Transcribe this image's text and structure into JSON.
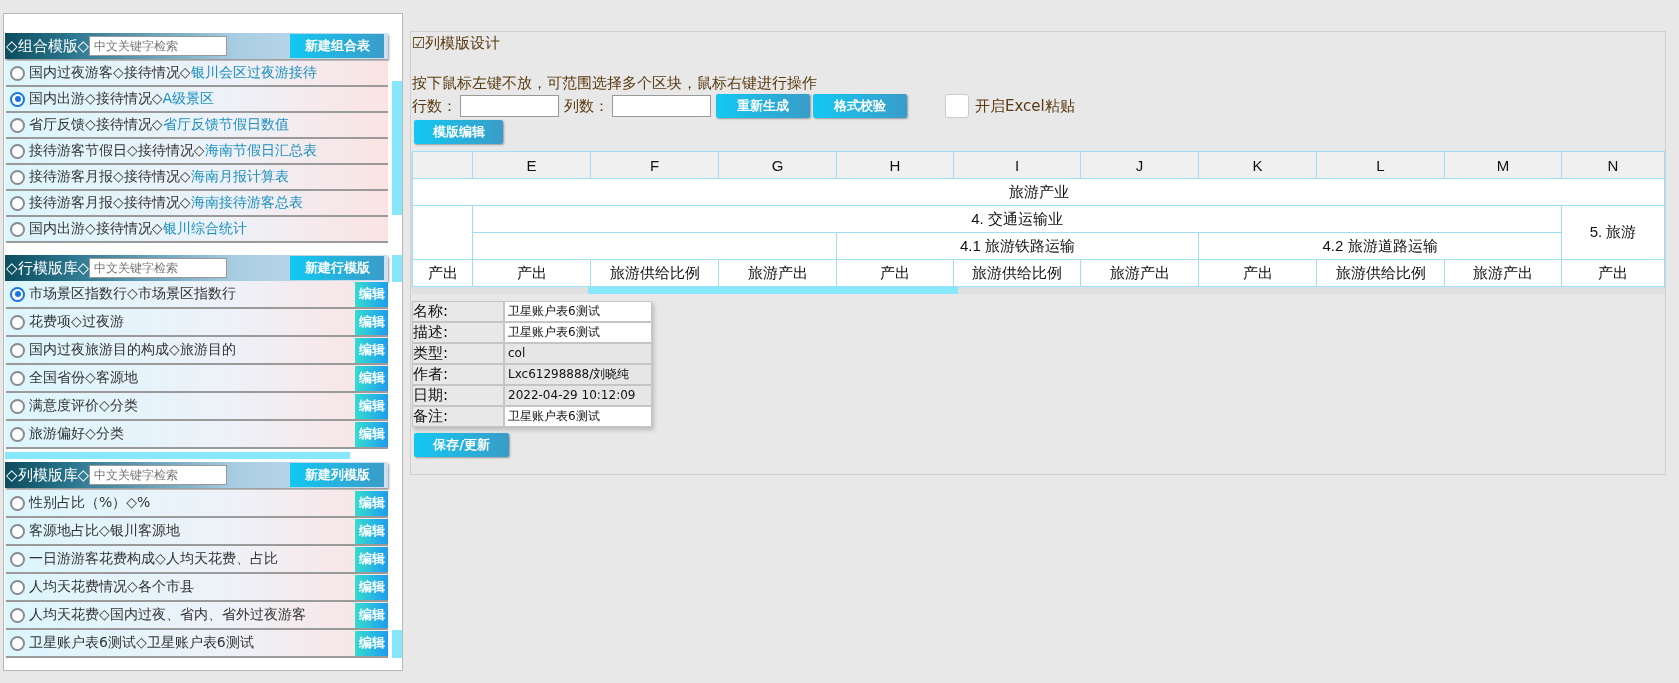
{
  "combo_section": {
    "title": "◇组合模版◇",
    "search": {
      "placeholder": "中文关键字检索"
    },
    "new_button": "新建组合表",
    "items": [
      {
        "text": "国内过夜游客◇接待情况◇",
        "link": "银川会区过夜游接待",
        "selected": false
      },
      {
        "text": "国内出游◇接待情况◇",
        "link": "A级景区",
        "selected": true
      },
      {
        "text": "省厅反馈◇接待情况◇",
        "link": "省厅反馈节假日数值",
        "selected": false
      },
      {
        "text": "接待游客节假日◇接待情况◇",
        "link": "海南节假日汇总表",
        "selected": false
      },
      {
        "text": "接待游客月报◇接待情况◇",
        "link": "海南月报计算表",
        "selected": false
      },
      {
        "text": "接待游客月报◇接待情况◇",
        "link": "海南接待游客总表",
        "selected": false
      },
      {
        "text": "国内出游◇接待情况◇",
        "link": "银川综合统计",
        "selected": false
      }
    ]
  },
  "row_section": {
    "title": "◇行模版库◇",
    "search": {
      "placeholder": "中文关键字检索"
    },
    "new_button": "新建行模版",
    "items": [
      {
        "text": "市场景区指数行◇市场景区指数行",
        "selected": true,
        "edit": "编辑"
      },
      {
        "text": "花费项◇过夜游",
        "selected": false,
        "edit": "编辑"
      },
      {
        "text": "国内过夜旅游目的构成◇旅游目的",
        "selected": false,
        "edit": "编辑"
      },
      {
        "text": "全国省份◇客源地",
        "selected": false,
        "edit": "编辑"
      },
      {
        "text": "满意度评价◇分类",
        "selected": false,
        "edit": "编辑"
      },
      {
        "text": "旅游偏好◇分类",
        "selected": false,
        "edit": "编辑"
      }
    ]
  },
  "col_section": {
    "title": "◇列模版库◇",
    "search": {
      "placeholder": "中文关键字检索"
    },
    "new_button": "新建列模版",
    "items": [
      {
        "text": "性别占比（%）◇%",
        "selected": false,
        "edit": "编辑"
      },
      {
        "text": "客源地占比◇银川客源地",
        "selected": false,
        "edit": "编辑"
      },
      {
        "text": "一日游游客花费构成◇人均天花费、占比",
        "selected": false,
        "edit": "编辑"
      },
      {
        "text": "人均天花费情况◇各个市县",
        "selected": false,
        "edit": "编辑"
      },
      {
        "text": "人均天花费◇国内过夜、省内、省外过夜游客",
        "selected": false,
        "edit": "编辑"
      },
      {
        "text": "卫星账户表6测试◇卫星账户表6测试",
        "selected": false,
        "edit": "编辑"
      }
    ]
  },
  "designer": {
    "title": "☑列模版设计",
    "hint": "按下鼠标左键不放，可范围选择多个区块，鼠标右键进行操作",
    "rows_label": "行数：",
    "cols_label": "列数：",
    "buttons": [
      "重新生成",
      "格式校验"
    ],
    "excel_paste": {
      "label": "开启Excel粘贴",
      "checked": false
    },
    "template_edit_button": "模版编辑",
    "grid": {
      "column_letters": [
        "E",
        "F",
        "G",
        "H",
        "I",
        "J",
        "K",
        "L",
        "M",
        "N"
      ],
      "rows": [
        [
          "",
          "",
          "",
          "",
          "",
          "旅游产业",
          "",
          "",
          "",
          "",
          ""
        ],
        [
          "",
          "",
          "",
          "",
          "",
          "4. 交通运输业",
          "",
          "",
          "",
          "",
          "5. 旅游"
        ],
        [
          "",
          "",
          "",
          "",
          "",
          "4.1 旅游铁路运输",
          "",
          "",
          "4.2 旅游道路运输",
          "",
          ""
        ],
        [
          "产出",
          "产出",
          "旅游供给比例",
          "旅游产出",
          "产出",
          "旅游供给比例",
          "旅游产出",
          "产出",
          "旅游供给比例",
          "旅游产出",
          "产出"
        ]
      ]
    },
    "info": [
      {
        "label": "名称:",
        "value": "卫星账户表6测试",
        "editable": true
      },
      {
        "label": "描述:",
        "value": "卫星账户表6测试",
        "editable": true
      },
      {
        "label": "类型:",
        "value": "col",
        "editable": false
      },
      {
        "label": "作者:",
        "value": "Lxc61298888/刘晓纯",
        "editable": false
      },
      {
        "label": "日期:",
        "value": "2022-04-29 10:12:09",
        "editable": false
      },
      {
        "label": "备注:",
        "value": "卫星账户表6测试",
        "editable": true
      }
    ],
    "save_button": "保存/更新"
  }
}
